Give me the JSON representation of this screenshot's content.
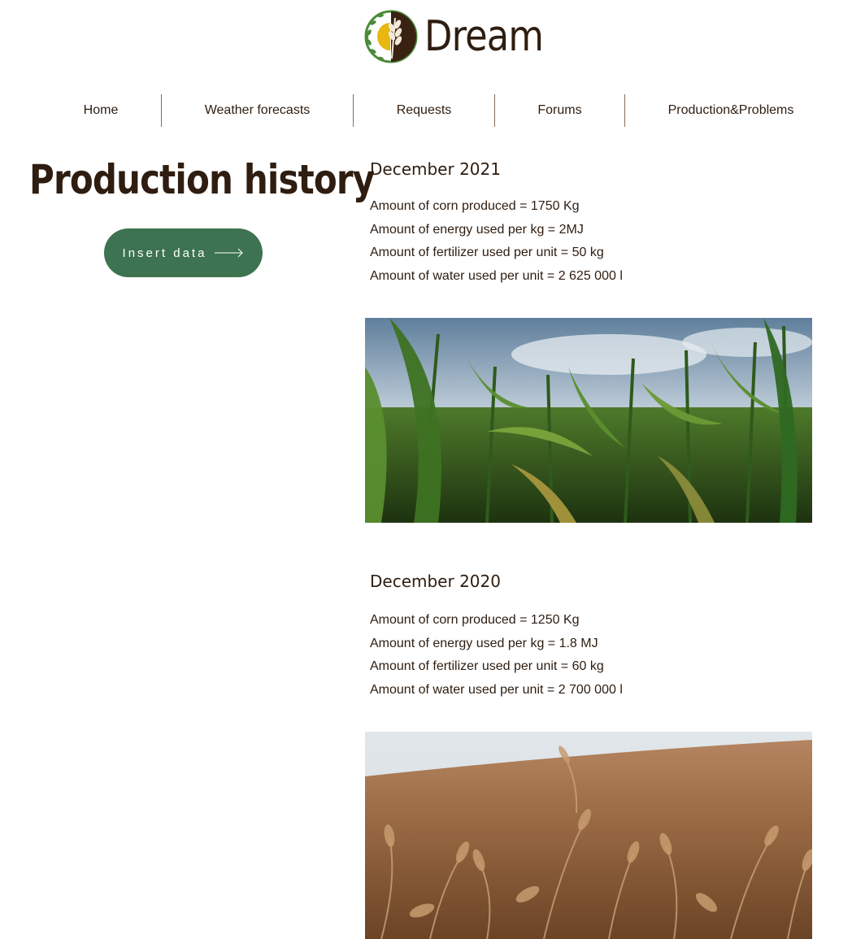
{
  "brand": {
    "name": "Dream",
    "colors": {
      "green": "#3d7350",
      "dark": "#2e1d10",
      "gold": "#e8b811"
    }
  },
  "nav": {
    "items": [
      {
        "label": "Home"
      },
      {
        "label": "Weather forecasts"
      },
      {
        "label": "Requests"
      },
      {
        "label": "Forums"
      },
      {
        "label": "Production&Problems"
      }
    ]
  },
  "main": {
    "title": "Production history",
    "insert_button": {
      "label": "Insert data",
      "icon": "arrow-right-icon"
    }
  },
  "entries": [
    {
      "heading": "December 2021",
      "stats": [
        "Amount of corn produced = 1750 Kg",
        "Amount of energy used per kg = 2MJ",
        "Amount of fertilizer used per unit = 50 kg",
        "Amount of water used per unit = 2 625 000 l"
      ],
      "image": "corn-field-photo"
    },
    {
      "heading": "December 2020",
      "stats": [
        "Amount of corn produced = 1250 Kg",
        "Amount of energy used per kg = 1.8 MJ",
        "Amount of fertilizer used per unit = 60 kg",
        "Amount of water used per unit = 2 700 000 l"
      ],
      "image": "wheat-field-photo"
    }
  ]
}
